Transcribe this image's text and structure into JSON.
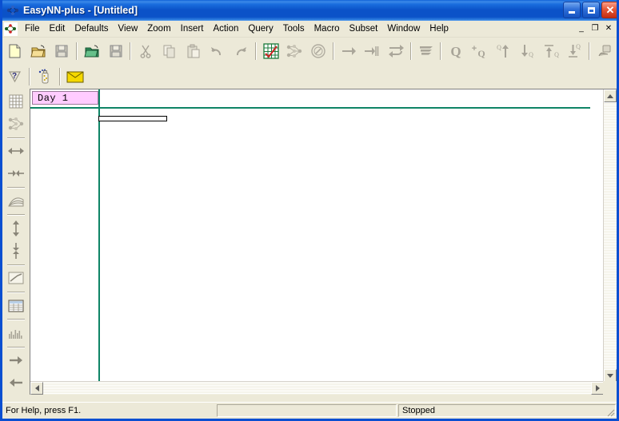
{
  "window": {
    "title": "EasyNN-plus - [Untitled]",
    "app_icon": "easynn-logo-icon",
    "controls": {
      "minimize": "minimize-button",
      "maximize": "maximize-button",
      "close": "close-button"
    }
  },
  "menu": {
    "items": [
      {
        "label": "File"
      },
      {
        "label": "Edit"
      },
      {
        "label": "Defaults"
      },
      {
        "label": "View"
      },
      {
        "label": "Zoom"
      },
      {
        "label": "Insert"
      },
      {
        "label": "Action"
      },
      {
        "label": "Query"
      },
      {
        "label": "Tools"
      },
      {
        "label": "Macro"
      },
      {
        "label": "Subset"
      },
      {
        "label": "Window"
      },
      {
        "label": "Help"
      }
    ],
    "mdi_controls": {
      "minimize": "_",
      "restore": "❐",
      "close": "✕"
    }
  },
  "toolbar_main": {
    "buttons": [
      {
        "name": "new-file-icon",
        "enabled": true
      },
      {
        "name": "open-file-icon",
        "enabled": true
      },
      {
        "name": "save-file-icon",
        "enabled": false
      },
      {
        "sep": true
      },
      {
        "name": "open-grid-icon",
        "enabled": true
      },
      {
        "name": "save-grid-icon",
        "enabled": false
      },
      {
        "sep": true
      },
      {
        "name": "cut-icon",
        "enabled": false
      },
      {
        "name": "copy-icon",
        "enabled": false
      },
      {
        "name": "paste-icon",
        "enabled": false
      },
      {
        "name": "undo-icon",
        "enabled": false
      },
      {
        "name": "redo-icon",
        "enabled": false
      },
      {
        "sep": true
      },
      {
        "name": "grid-chart-icon",
        "enabled": true
      },
      {
        "name": "neural-network-icon",
        "enabled": false
      },
      {
        "name": "compass-dial-icon",
        "enabled": false
      },
      {
        "sep": true
      },
      {
        "name": "arrow-right-icon",
        "enabled": false
      },
      {
        "name": "arrow-to-bar-icon",
        "enabled": false
      },
      {
        "name": "arrow-return-icon",
        "enabled": false
      },
      {
        "sep": true
      },
      {
        "name": "layers-icon",
        "enabled": false
      },
      {
        "sep": true
      },
      {
        "name": "query-icon",
        "enabled": false
      },
      {
        "name": "add-query-icon",
        "enabled": false
      },
      {
        "name": "query-up-icon",
        "enabled": false
      },
      {
        "name": "query-down-icon",
        "enabled": false
      },
      {
        "name": "query-top-icon",
        "enabled": false
      },
      {
        "name": "query-bottom-icon",
        "enabled": false
      },
      {
        "sep": true
      },
      {
        "name": "lock-hand-icon",
        "enabled": false
      }
    ]
  },
  "toolbar_secondary": {
    "buttons": [
      {
        "name": "help-arrow-icon",
        "enabled": false
      },
      {
        "sep": true
      },
      {
        "name": "wizard-bottle-icon",
        "enabled": false
      },
      {
        "sep": true
      },
      {
        "name": "mail-envelope-icon",
        "enabled": true
      }
    ]
  },
  "toolbar_left": {
    "buttons": [
      {
        "name": "grid-view-icon",
        "enabled": false
      },
      {
        "name": "network-view-icon",
        "enabled": false
      },
      {
        "sep": true
      },
      {
        "name": "expand-horizontal-icon",
        "enabled": false
      },
      {
        "name": "contract-horizontal-icon",
        "enabled": false
      },
      {
        "sep": true
      },
      {
        "name": "curve-graph-icon",
        "enabled": false
      },
      {
        "sep": true
      },
      {
        "name": "expand-vertical-icon",
        "enabled": false
      },
      {
        "name": "contract-vertical-icon",
        "enabled": false
      },
      {
        "sep": true
      },
      {
        "name": "line-chart-icon",
        "enabled": false
      },
      {
        "sep": true
      },
      {
        "name": "table-view-icon",
        "enabled": false
      },
      {
        "sep": true
      },
      {
        "name": "bar-chart-icon",
        "enabled": false
      },
      {
        "sep": true
      },
      {
        "name": "step-forward-icon",
        "enabled": false
      },
      {
        "name": "step-back-icon",
        "enabled": false
      }
    ]
  },
  "grid": {
    "column_header": "Day 1",
    "header_bg": "#ffccff",
    "gridline_color": "#0f8466",
    "bar": {
      "name": "data-bar",
      "fill": "#ffffff",
      "stroke": "#000000"
    }
  },
  "scrollbars": {
    "vertical": {
      "up": "scroll-up-arrow",
      "down": "scroll-down-arrow"
    },
    "horizontal": {
      "left": "scroll-left-arrow",
      "right": "scroll-right-arrow"
    }
  },
  "statusbar": {
    "help_text": "For Help, press F1.",
    "middle_text": "",
    "state_text": "Stopped"
  }
}
